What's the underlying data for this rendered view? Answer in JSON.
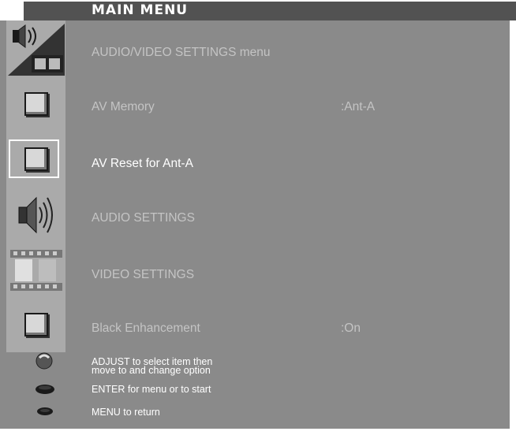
{
  "title": "MAIN MENU",
  "menu": [
    {
      "label": "AUDIO/VIDEO SETTINGS menu",
      "value": "",
      "icon": "speaker-film-icon"
    },
    {
      "label": "AV Memory",
      "value": ":Ant-A",
      "icon": "square-icon"
    },
    {
      "label": "AV Reset for Ant-A",
      "value": "",
      "icon": "square-icon",
      "selected": true
    },
    {
      "label": "AUDIO SETTINGS",
      "value": "",
      "icon": "speaker-icon"
    },
    {
      "label": "VIDEO SETTINGS",
      "value": "",
      "icon": "film-icon"
    },
    {
      "label": "Black Enhancement",
      "value": ":On",
      "icon": "square-icon"
    }
  ],
  "help": {
    "adjust_line1": "ADJUST to select item then",
    "adjust_line2": "move to and change option",
    "enter": "ENTER for menu or to start",
    "menu": "MENU to return"
  },
  "colors": {
    "panel": "#8a8a8a",
    "icon_column": "#aaaaaa",
    "title_bar": "#525252",
    "text_dim": "#c4c4c4",
    "text_selected": "#ffffff"
  }
}
